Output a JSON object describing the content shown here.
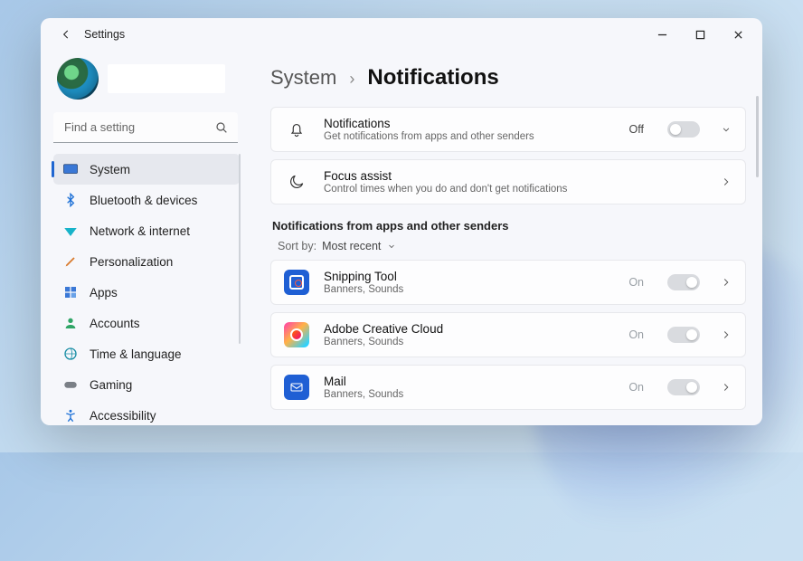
{
  "app_title": "Settings",
  "search": {
    "placeholder": "Find a setting"
  },
  "sidebar": {
    "items": [
      {
        "label": "System"
      },
      {
        "label": "Bluetooth & devices"
      },
      {
        "label": "Network & internet"
      },
      {
        "label": "Personalization"
      },
      {
        "label": "Apps"
      },
      {
        "label": "Accounts"
      },
      {
        "label": "Time & language"
      },
      {
        "label": "Gaming"
      },
      {
        "label": "Accessibility"
      }
    ]
  },
  "breadcrumb": {
    "parent": "System",
    "current": "Notifications"
  },
  "cards": {
    "notifications": {
      "title": "Notifications",
      "subtitle": "Get notifications from apps and other senders",
      "state": "Off"
    },
    "focus": {
      "title": "Focus assist",
      "subtitle": "Control times when you do and don't get notifications"
    }
  },
  "section_title": "Notifications from apps and other senders",
  "sort": {
    "label": "Sort by:",
    "value": "Most recent"
  },
  "apps": [
    {
      "name": "Snipping Tool",
      "detail": "Banners, Sounds",
      "state": "On"
    },
    {
      "name": "Adobe Creative Cloud",
      "detail": "Banners, Sounds",
      "state": "On"
    },
    {
      "name": "Mail",
      "detail": "Banners, Sounds",
      "state": "On"
    }
  ]
}
